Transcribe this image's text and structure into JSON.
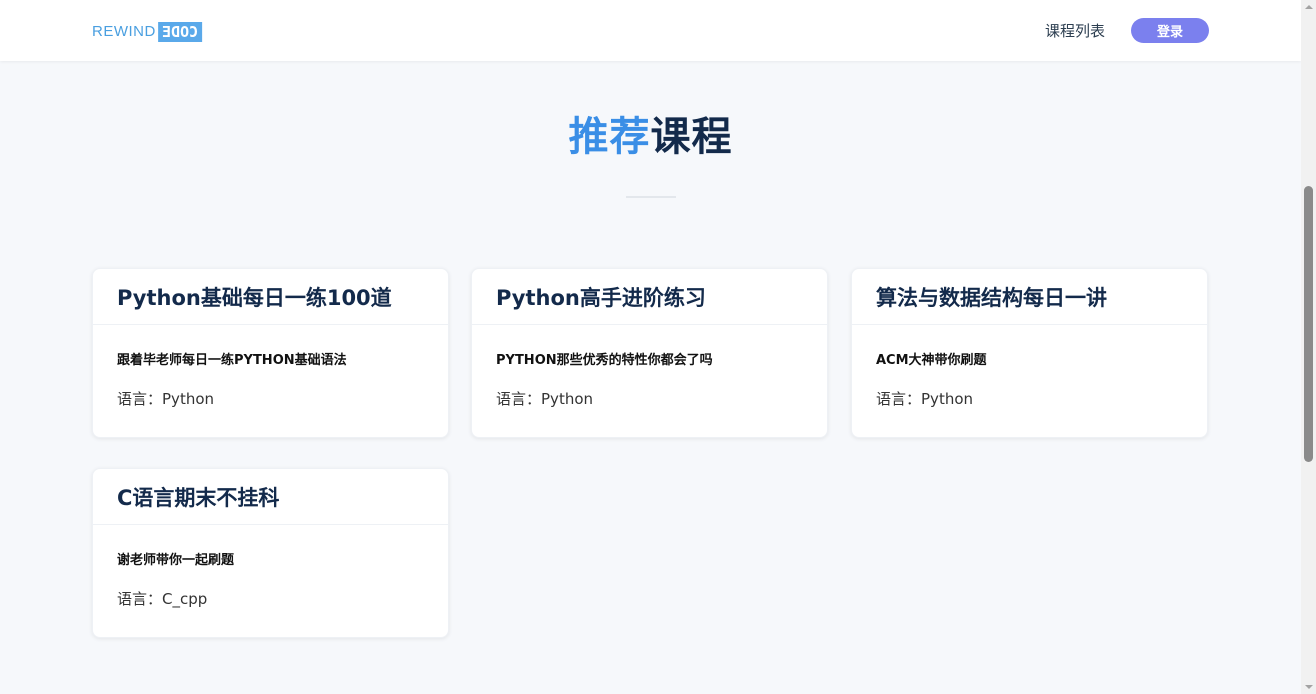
{
  "header": {
    "logo_left": "REWIND",
    "logo_right": "CODE",
    "nav_course_list": "课程列表",
    "login_label": "登录"
  },
  "section": {
    "title_accent": "推荐",
    "title_rest": "课程"
  },
  "courses": [
    {
      "title": "Python基础每日一练100道",
      "desc": "跟着毕老师每日一练PYTHON基础语法",
      "lang_label": "语言：",
      "lang": "Python"
    },
    {
      "title": "Python高手进阶练习",
      "desc": "PYTHON那些优秀的特性你都会了吗",
      "lang_label": "语言：",
      "lang": "Python"
    },
    {
      "title": "算法与数据结构每日一讲",
      "desc": "ACM大神带你刷题",
      "lang_label": "语言：",
      "lang": "Python"
    },
    {
      "title": "C语言期末不挂科",
      "desc": "谢老师带你一起刷题",
      "lang_label": "语言：",
      "lang": "C_cpp"
    }
  ],
  "colors": {
    "accent": "#3a8ee6",
    "login_button": "#7b80ee",
    "title_dark": "#132a4b"
  }
}
